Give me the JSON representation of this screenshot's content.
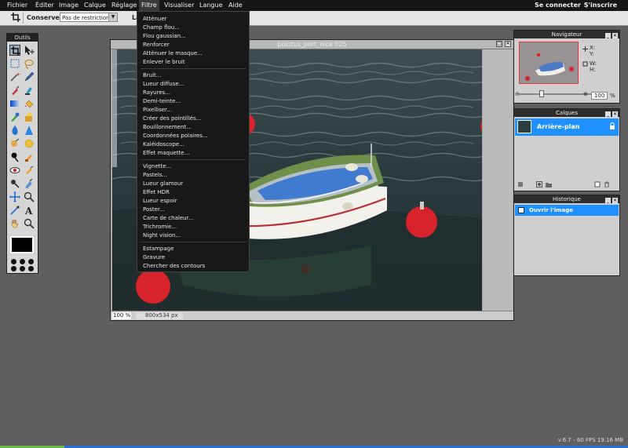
{
  "menubar": {
    "items": [
      "Fichier",
      "Éditer",
      "Image",
      "Calque",
      "Réglage",
      "Filtre",
      "Visualiser",
      "Langue",
      "Aide"
    ],
    "login": "Se connecter",
    "signup": "S'inscrire"
  },
  "toolbar": {
    "conserve_label": "Conserver :",
    "conserve_value": "Pas de restriction",
    "width_label": "La"
  },
  "tools_panel": {
    "title": "Outils"
  },
  "image_window": {
    "title": "pointus_port_nice 025",
    "zoom": "100 %",
    "size": "800x534 px"
  },
  "filter_menu": {
    "groups": [
      [
        "Atténuer",
        "Champ flou...",
        "Flou gaussian...",
        "Renforcer",
        "Atténuer le masque...",
        "Enlever le bruit"
      ],
      [
        "Bruit...",
        "Lueur diffuse...",
        "Rayures...",
        "Demi-teinte...",
        "Pixelliser...",
        "Créer des pointillés...",
        "Bouillonnement...",
        "Coordonnées polaires...",
        "Kaléidoscope...",
        "Effet maquette..."
      ],
      [
        "Vignette...",
        "Pastels...",
        "Lueur glamour",
        "Effet HDR",
        "Lueur espoir",
        "Poster...",
        "Carte de chaleur...",
        "Trichromie...",
        "Night vision..."
      ],
      [
        "Estampage",
        "Gravure",
        "Chercher des contours"
      ]
    ]
  },
  "navigator": {
    "title": "Navigateur",
    "x_label": "X:",
    "y_label": "Y:",
    "w_label": "W:",
    "h_label": "H:",
    "zoom": "100",
    "pct": "%"
  },
  "layers": {
    "title": "Calques",
    "items": [
      {
        "name": "Arrière-plan"
      }
    ]
  },
  "history": {
    "title": "Historique",
    "items": [
      {
        "label": "Ouvrir l'image"
      }
    ]
  },
  "footer": {
    "version": "v.6.7 - 60 FPS 19.16 MB"
  },
  "colors": {
    "accent": "#1e90ff",
    "menu_bg": "#181818",
    "buoy": "#d9232a"
  }
}
